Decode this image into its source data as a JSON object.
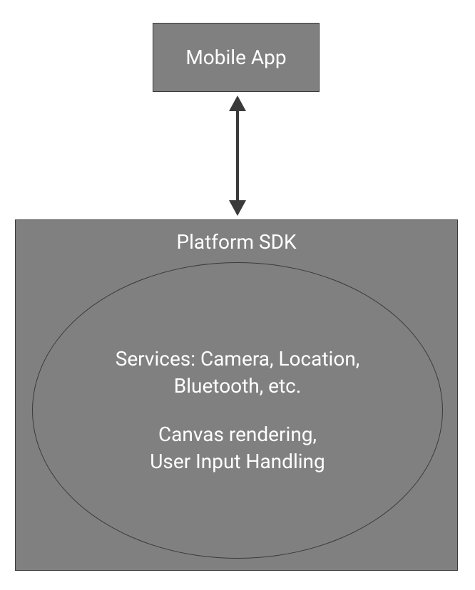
{
  "mobile_app": {
    "label": "Mobile App"
  },
  "platform_sdk": {
    "title": "Platform SDK",
    "services_line1": "Services: Camera, Location,",
    "services_line2": "Bluetooth, etc.",
    "canvas_line1": "Canvas rendering,",
    "canvas_line2": "User Input Handling"
  }
}
